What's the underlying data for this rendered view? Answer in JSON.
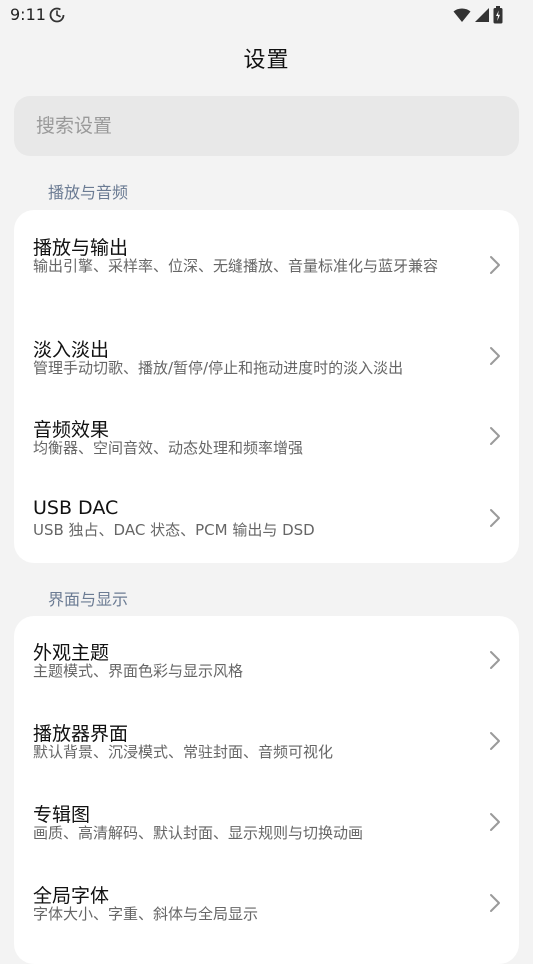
{
  "status_bar": {
    "time": "9:11",
    "icons": [
      "sync-icon",
      "wifi-icon",
      "signal-icon",
      "battery-icon"
    ]
  },
  "header": {
    "title": "设置"
  },
  "search": {
    "placeholder": "搜索设置",
    "value": ""
  },
  "sections": [
    {
      "header": "播放与音频",
      "items": [
        {
          "title": "播放与输出",
          "desc": "输出引擎、采样率、位深、无缝播放、音量标准化与蓝牙兼容"
        },
        {
          "title": "淡入淡出",
          "desc": "管理手动切歌、播放/暂停/停止和拖动进度时的淡入淡出"
        },
        {
          "title": "音频效果",
          "desc": "均衡器、空间音效、动态处理和频率增强"
        },
        {
          "title": "USB DAC",
          "desc": "USB 独占、DAC 状态、PCM 输出与 DSD"
        }
      ]
    },
    {
      "header": "界面与显示",
      "items": [
        {
          "title": "外观主题",
          "desc": "主题模式、界面色彩与显示风格"
        },
        {
          "title": "播放器界面",
          "desc": "默认背景、沉浸模式、常驻封面、音频可视化"
        },
        {
          "title": "专辑图",
          "desc": "画质、高清解码、默认封面、显示规则与切换动画"
        },
        {
          "title": "全局字体",
          "desc": "字体大小、字重、斜体与全局显示"
        }
      ]
    }
  ],
  "colors": {
    "background": "#f3f3f3",
    "card": "#ffffff",
    "search_bg": "#e8e8e8",
    "section_header": "#6b7b93",
    "title_text": "#111111",
    "desc_text": "#666666",
    "chevron": "#9a9a9a"
  }
}
